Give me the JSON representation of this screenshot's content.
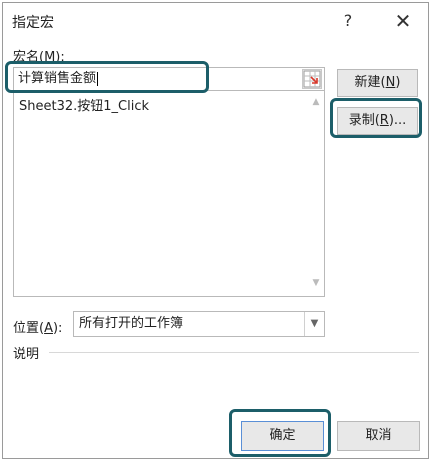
{
  "window": {
    "title": "指定宏",
    "help_label": "?",
    "close_label": "✕"
  },
  "macro_name": {
    "label": "宏名(",
    "accel": "M",
    "label_end": "):",
    "value": "计算销售金额",
    "ref_icon": "cell-reference-icon"
  },
  "macro_list": {
    "items": [
      "Sheet32.按钮1_Click"
    ]
  },
  "buttons": {
    "new": {
      "label": "新建(",
      "accel": "N",
      "end": ")"
    },
    "record": {
      "label": "录制(",
      "accel": "R",
      "end": ")..."
    },
    "ok": "确定",
    "cancel": "取消"
  },
  "location": {
    "label": "位置(",
    "accel": "A",
    "label_end": "):",
    "value": "所有打开的工作簿"
  },
  "description": {
    "label": "说明"
  },
  "colors": {
    "highlight": "#1c5e69",
    "accent": "#5a8fd6"
  }
}
